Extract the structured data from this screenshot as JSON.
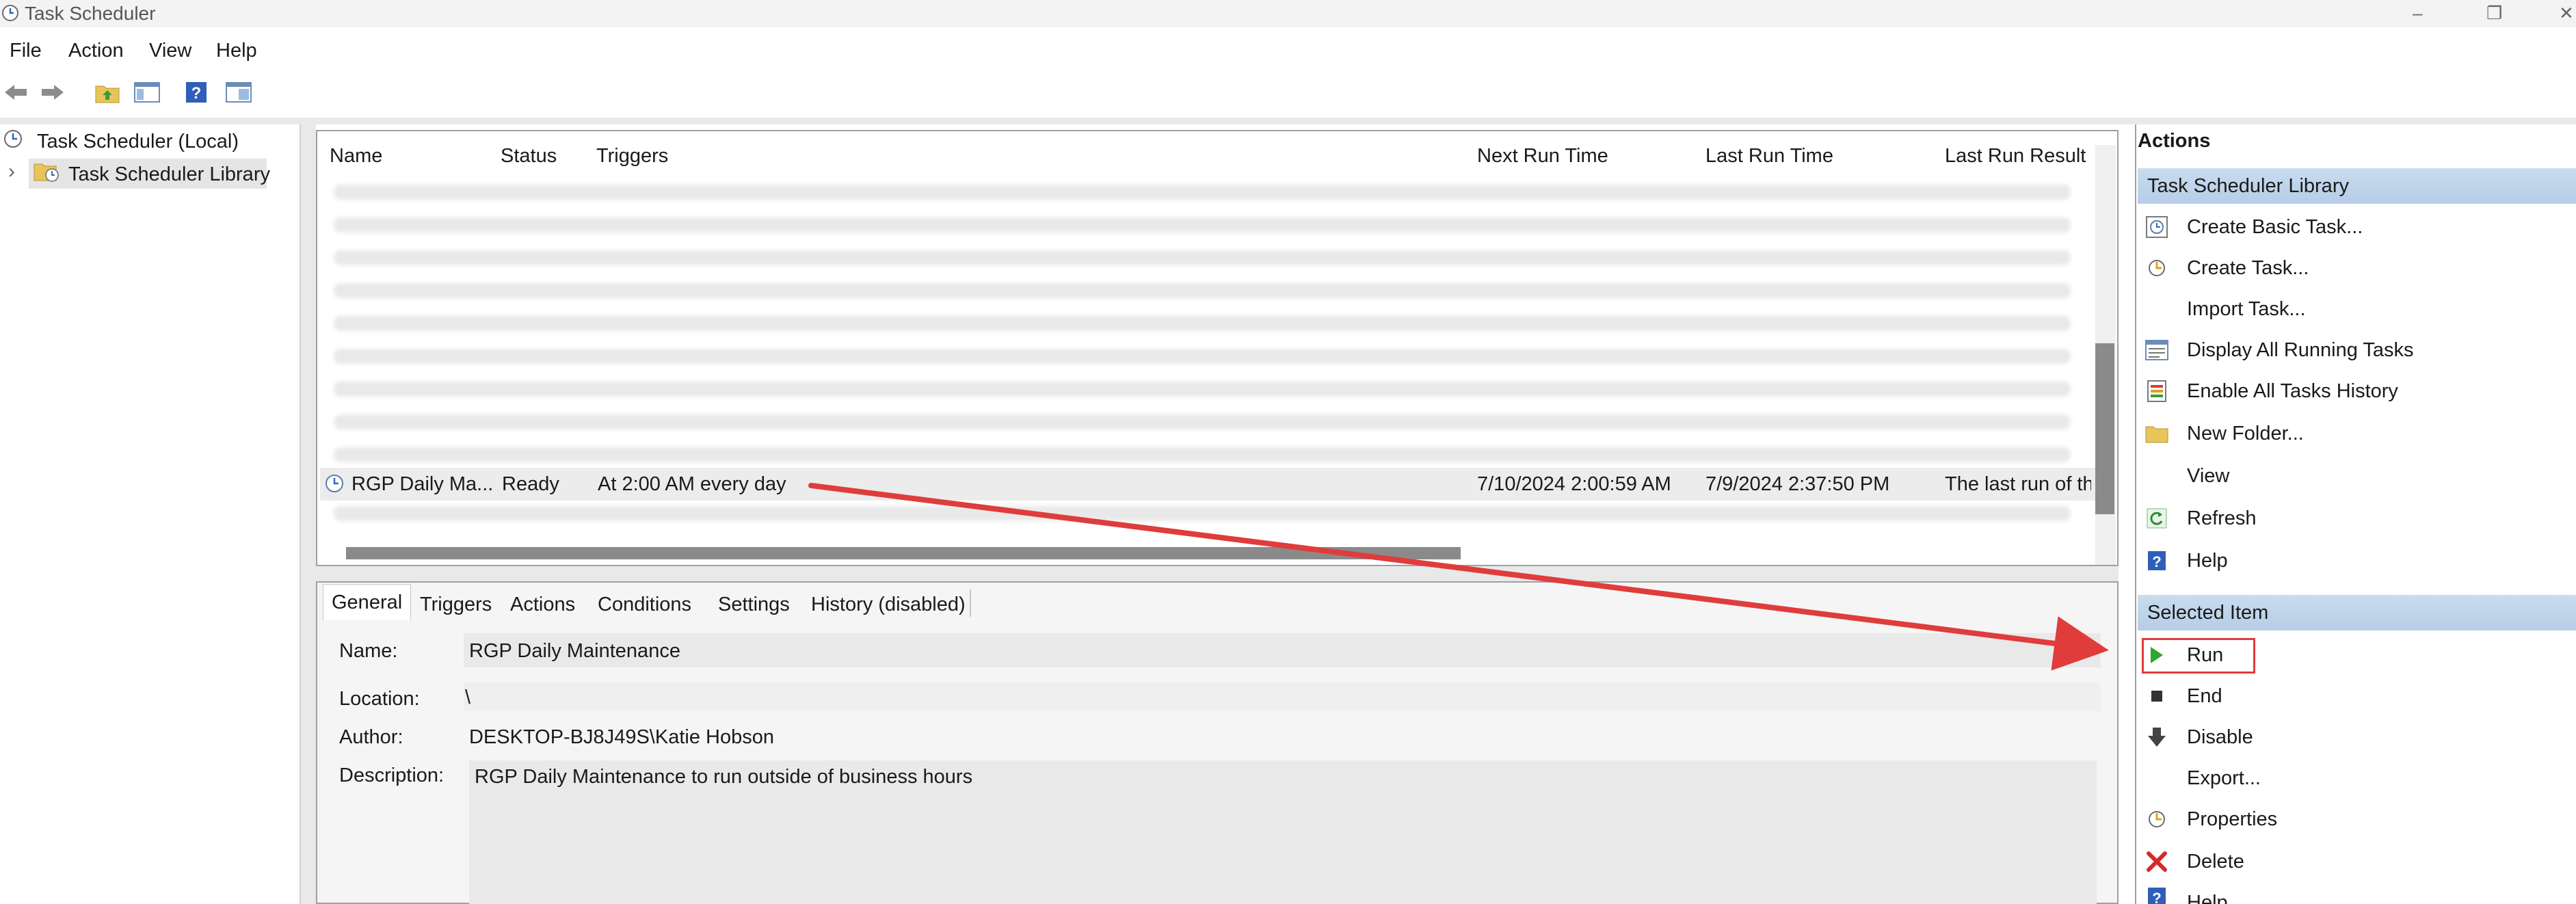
{
  "window": {
    "title": "Task Scheduler",
    "minimize_glyph": "–",
    "maximize_glyph": "❐",
    "close_glyph": "✕"
  },
  "menu": [
    "File",
    "Action",
    "View",
    "Help"
  ],
  "toolbar": {
    "icons": [
      "back-arrow-icon",
      "forward-arrow-icon",
      "folder-up-icon",
      "show-hide-console-tree-icon",
      "help-icon",
      "properties-icon"
    ]
  },
  "tree": {
    "root_label": "Task Scheduler (Local)",
    "library_label": "Task Scheduler Library",
    "expand_glyph": "›"
  },
  "task_list": {
    "columns": [
      "Name",
      "Status",
      "Triggers",
      "Next Run Time",
      "Last Run Time",
      "Last Run Result"
    ],
    "selected_row": {
      "name": "RGP Daily Ma...",
      "status": "Ready",
      "trigger": "At 2:00 AM every day",
      "next_run_time": "7/10/2024 2:00:59 AM",
      "last_run_time": "7/9/2024 2:37:50 PM",
      "last_run_result": "The last run of th"
    }
  },
  "detail": {
    "tabs": [
      "General",
      "Triggers",
      "Actions",
      "Conditions",
      "Settings",
      "History (disabled)"
    ],
    "fields": {
      "name_label": "Name:",
      "name_value": "RGP Daily Maintenance",
      "location_label": "Location:",
      "location_value": "\\",
      "author_label": "Author:",
      "author_value": "DESKTOP-BJ8J49S\\Katie Hobson",
      "description_label": "Description:",
      "description_value": "RGP Daily Maintenance to run outside of business hours"
    }
  },
  "actions": {
    "header": "Actions",
    "section_library": "Task Scheduler Library",
    "library_items": [
      {
        "label": "Create Basic Task...",
        "icon": "create-basic-task-icon"
      },
      {
        "label": "Create Task...",
        "icon": "create-task-icon"
      },
      {
        "label": "Import Task...",
        "icon": ""
      },
      {
        "label": "Display All Running Tasks",
        "icon": "running-tasks-icon"
      },
      {
        "label": "Enable All Tasks History",
        "icon": "history-icon"
      },
      {
        "label": "New Folder...",
        "icon": "new-folder-icon"
      },
      {
        "label": "View",
        "icon": ""
      },
      {
        "label": "Refresh",
        "icon": "refresh-icon"
      },
      {
        "label": "Help",
        "icon": "help-icon"
      }
    ],
    "section_selected": "Selected Item",
    "selected_items": [
      {
        "label": "Run",
        "icon": "run-icon"
      },
      {
        "label": "End",
        "icon": "end-icon"
      },
      {
        "label": "Disable",
        "icon": "disable-icon"
      },
      {
        "label": "Export...",
        "icon": ""
      },
      {
        "label": "Properties",
        "icon": "properties-icon"
      },
      {
        "label": "Delete",
        "icon": "delete-icon"
      },
      {
        "label": "Help",
        "icon": "help-icon"
      }
    ]
  },
  "colors": {
    "annotation_red": "#e03c3c",
    "section_header_blue": "#bfd4ea"
  }
}
